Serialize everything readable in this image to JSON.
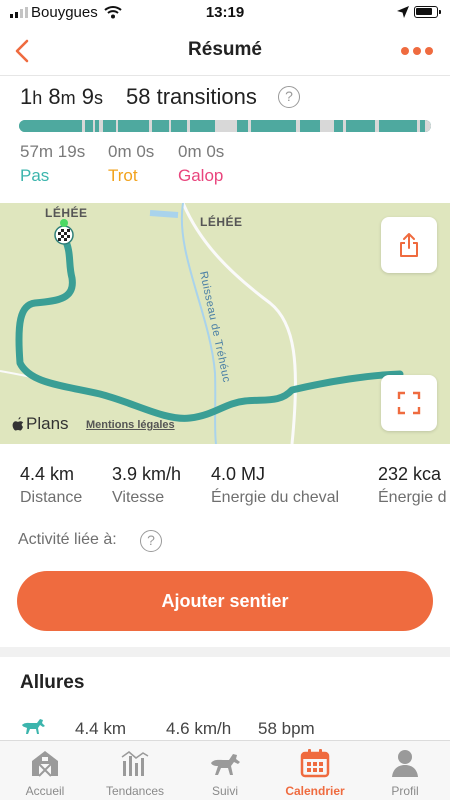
{
  "status_bar": {
    "carrier": "Bouygues",
    "time": "13:19"
  },
  "nav": {
    "title": "Résumé",
    "back_icon": "chevron-left-icon",
    "more_icon": "more-dots-icon"
  },
  "summary": {
    "duration_h": "1",
    "duration_m": "8",
    "duration_s": "9",
    "transitions": "58 transitions",
    "gaits": [
      {
        "time": "57m 19s",
        "label": "Pas",
        "color": "#3cb5ad"
      },
      {
        "time": "0m 0s",
        "label": "Trot",
        "color": "#f2a21c"
      },
      {
        "time": "0m 0s",
        "label": "Galop",
        "color": "#e9457d"
      }
    ]
  },
  "map": {
    "labels": [
      "LÉHÉE",
      "LÉHÉE"
    ],
    "stream_label": "Ruisseau de Tréhéuc",
    "logo_text": "Plans",
    "legal_text": "Mentions légales"
  },
  "stats": [
    {
      "value": "4.4 km",
      "label": "Distance"
    },
    {
      "value": "3.9 km/h",
      "label": "Vitesse"
    },
    {
      "value": "4.0 MJ",
      "label": "Énergie du cheval"
    },
    {
      "value": "232 kca",
      "label": "Énergie d"
    }
  ],
  "linked_label": "Activité liée à:",
  "add_trail_label": "Ajouter sentier",
  "allures": {
    "title": "Allures",
    "row": {
      "distance": "4.4 km",
      "speed": "4.6 km/h",
      "heart_rate": "58 bpm"
    }
  },
  "tabs": [
    {
      "label": "Accueil",
      "icon": "barn-icon",
      "active": false
    },
    {
      "label": "Tendances",
      "icon": "chart-bars-icon",
      "active": false
    },
    {
      "label": "Suivi",
      "icon": "horse-icon",
      "active": false
    },
    {
      "label": "Calendrier",
      "icon": "calendar-icon",
      "active": true
    },
    {
      "label": "Profil",
      "icon": "person-icon",
      "active": false
    }
  ],
  "colors": {
    "accent": "#ef6b3f",
    "route": "#3a9e95",
    "map_bg": "#dfe6be"
  }
}
